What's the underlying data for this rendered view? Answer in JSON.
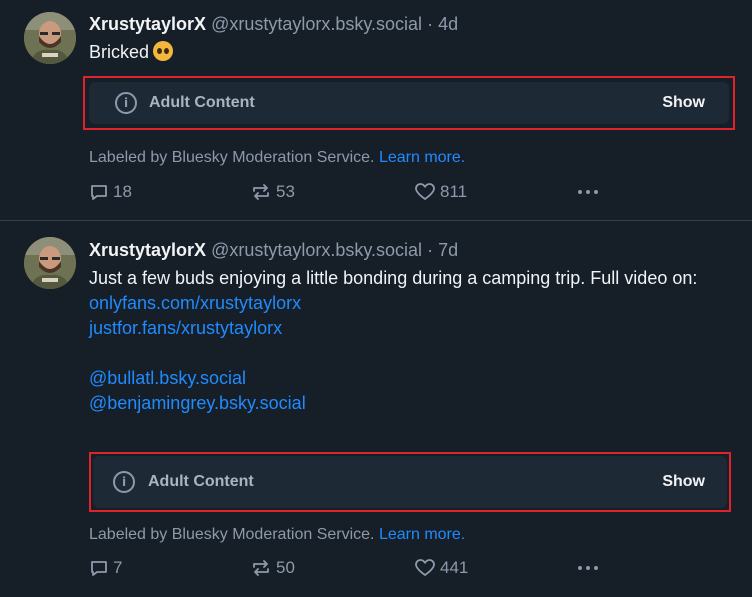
{
  "posts": [
    {
      "author_name": "XrustytaylorX",
      "handle": "@xrustytaylorx.bsky.social",
      "separator": "·",
      "time": "4d",
      "text": "Bricked",
      "emoji": "pleading-face-emoji",
      "content_warning": {
        "icon": "info-icon",
        "label": "Adult Content",
        "show_label": "Show"
      },
      "moderation": {
        "text": "Labeled by Bluesky Moderation Service.",
        "link": "Learn more."
      },
      "stats": {
        "replies": "18",
        "reposts": "53",
        "likes": "811"
      }
    },
    {
      "author_name": "XrustytaylorX",
      "handle": "@xrustytaylorx.bsky.social",
      "separator": "·",
      "time": "7d",
      "text": "Just a few buds enjoying a little bonding during a camping trip. Full video on:",
      "links": [
        "onlyfans.com/xrustytaylorx",
        "justfor.fans/xrustytaylorx"
      ],
      "mentions": [
        "@bullatl.bsky.social",
        "@benjamingrey.bsky.social"
      ],
      "content_warning": {
        "icon": "info-icon",
        "label": "Adult Content",
        "show_label": "Show"
      },
      "moderation": {
        "text": "Labeled by Bluesky Moderation Service.",
        "link": "Learn more."
      },
      "stats": {
        "replies": "7",
        "reposts": "50",
        "likes": "441"
      }
    }
  ],
  "icons": {
    "reply": "reply-icon",
    "repost": "repost-icon",
    "like": "heart-icon",
    "more": "more-options-icon"
  },
  "colors": {
    "background": "#161e27",
    "link": "#208bfe",
    "muted": "#8d9aab",
    "highlight_border": "#e0222a"
  }
}
